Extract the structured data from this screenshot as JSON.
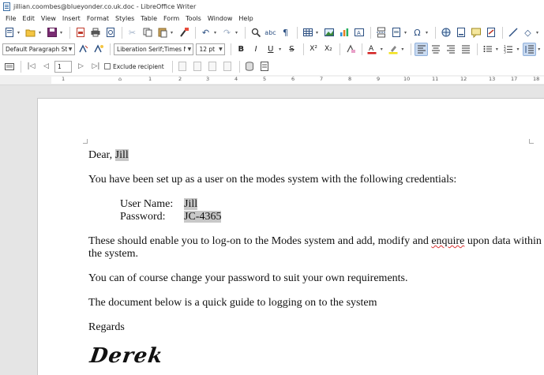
{
  "window": {
    "title": "jillian.coombes@blueyonder.co.uk.doc - LibreOffice Writer"
  },
  "menu": [
    "File",
    "Edit",
    "View",
    "Insert",
    "Format",
    "Styles",
    "Table",
    "Form",
    "Tools",
    "Window",
    "Help"
  ],
  "formatting": {
    "paragraph_style": "Default Paragraph Style",
    "font_name": "Liberation Serif;Times New Rom",
    "font_size": "12 pt"
  },
  "mailmerge": {
    "record": "1",
    "exclude_label": "Exclude recipient"
  },
  "ruler": {
    "numbers": [
      "1",
      "1",
      "2",
      "3",
      "4",
      "5",
      "6",
      "7",
      "8",
      "9",
      "10",
      "11",
      "12",
      "13",
      "14",
      "15",
      "16",
      "17",
      "18"
    ]
  },
  "document": {
    "greeting": "Dear,",
    "recipient_name": "Jill",
    "intro": "You have been set up as a user on the modes system with the following credentials:",
    "username_label": "User Name:",
    "username_value": "Jill",
    "password_label": "Password:",
    "password_value": "JC-4365",
    "para2_a": "These should enable you to log-on to the Modes system and add, modify and ",
    "para2_misspelled": "enquire",
    "para2_b": " upon data within",
    "para2_line2": "the system.",
    "para3": "You can of course change your password to suit your own requirements.",
    "para4": "The document below is a quick guide to logging on to the system",
    "closing": "Regards",
    "signature": "Derek"
  },
  "colors": {
    "accent": "#2b4f82",
    "font_color_bar": "#d21f1f",
    "highlight_bar": "#f2e11b",
    "field_shading": "#c8c8c8"
  }
}
